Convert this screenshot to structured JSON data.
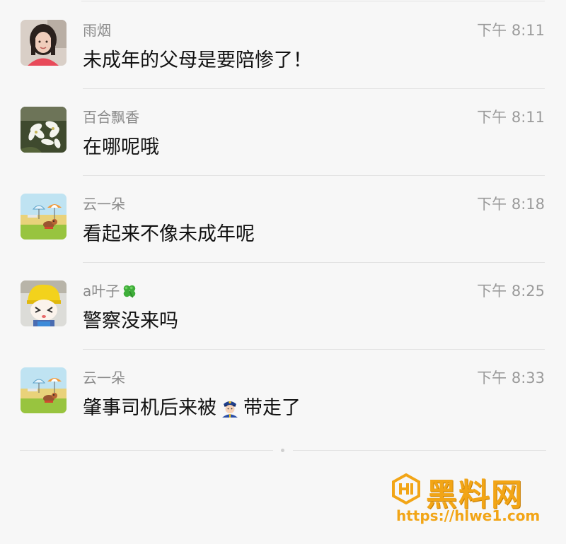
{
  "messages": [
    {
      "sender": "雨烟",
      "time": "下午 8:11",
      "text": "未成年的父母是要陪惨了！",
      "avatar": "woman-photo"
    },
    {
      "sender": "百合飘香",
      "time": "下午 8:11",
      "text": "在哪呢哦",
      "avatar": "lily-flowers"
    },
    {
      "sender": "云一朵",
      "time": "下午 8:18",
      "text": "看起来不像未成年呢",
      "avatar": "beach-cartoon"
    },
    {
      "sender": "a叶子",
      "sender_emoji": "four-leaf-clover",
      "time": "下午 8:25",
      "text": "警察没来吗",
      "avatar": "yellow-helmet-cartoon"
    },
    {
      "sender": "云一朵",
      "time": "下午 8:33",
      "text_before": "肇事司机后来被",
      "text_emoji": "police-officer",
      "text_after": "带走了",
      "avatar": "beach-cartoon"
    }
  ],
  "watermark": {
    "name": "黑料网",
    "url": "https://hlwe1.com"
  },
  "colors": {
    "background": "#f7f7f7",
    "sender": "#8a8a8a",
    "timestamp": "#9a9a9a",
    "text": "#111111",
    "divider": "#e2e2e2",
    "watermark": "#f2a516"
  }
}
